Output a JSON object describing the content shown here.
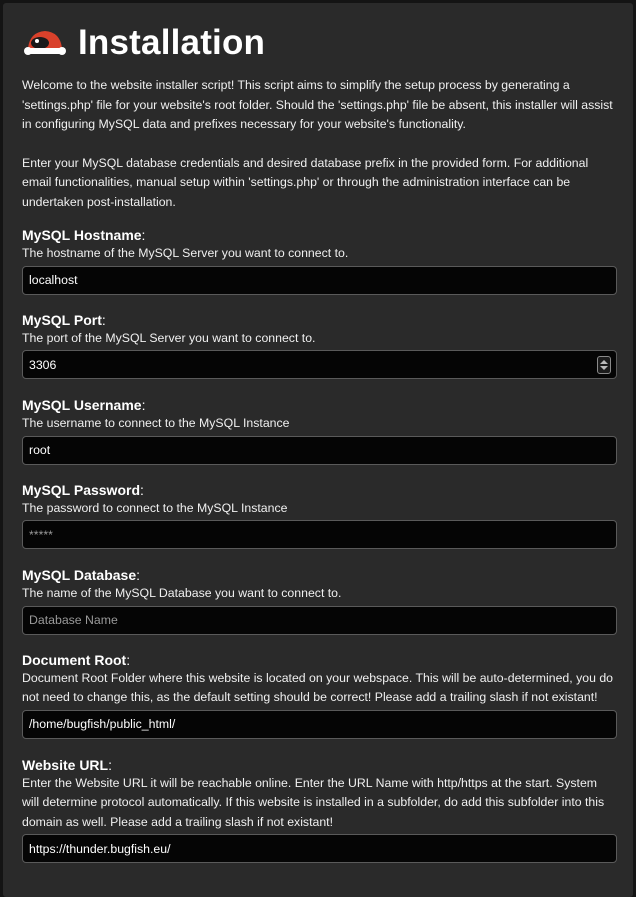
{
  "page": {
    "title": "Installation",
    "logo_icon": "bugfish-logo-icon",
    "intro_1": "Welcome to the website installer script! This script aims to simplify the setup process by generating a 'settings.php' file for your website's root folder. Should the 'settings.php' file be absent, this installer will assist in configuring MySQL data and prefixes necessary for your website's functionality.",
    "intro_2": "Enter your MySQL database credentials and desired database prefix in the provided form. For additional email functionalities, manual setup within 'settings.php' or through the administration interface can be undertaken post-installation."
  },
  "fields": {
    "hostname": {
      "label": "MySQL Hostname",
      "desc": "The hostname of the MySQL Server you want to connect to.",
      "value": "localhost",
      "placeholder": ""
    },
    "port": {
      "label": "MySQL Port",
      "desc": "The port of the MySQL Server you want to connect to.",
      "value": "3306",
      "placeholder": ""
    },
    "username": {
      "label": "MySQL Username",
      "desc": "The username to connect to the MySQL Instance",
      "value": "root",
      "placeholder": ""
    },
    "password": {
      "label": "MySQL Password",
      "desc": "The password to connect to the MySQL Instance",
      "value": "",
      "placeholder": "*****"
    },
    "database": {
      "label": "MySQL Database",
      "desc": "The name of the MySQL Database you want to connect to.",
      "value": "",
      "placeholder": "Database Name"
    },
    "docroot": {
      "label": "Document Root",
      "desc": "Document Root Folder where this website is located on your webspace. This will be auto-determined, you do not need to change this, as the default setting should be correct! Please add a trailing slash if not existant!",
      "value": "/home/bugfish/public_html/",
      "placeholder": ""
    },
    "url": {
      "label": "Website URL",
      "desc": "Enter the Website URL it will be reachable online. Enter the URL Name with http/https at the start. System will determine protocol automatically. If this website is installed in a subfolder, do add this subfolder into this domain as well. Please add a trailing slash if not existant!",
      "value": "https://thunder.bugfish.eu/",
      "placeholder": ""
    }
  },
  "colors": {
    "background": "#141414",
    "panel": "#2a2a2a",
    "input_bg": "#050505",
    "input_border": "#5a5a5a",
    "text": "#f0f0f0",
    "logo_red": "#d9412b"
  }
}
